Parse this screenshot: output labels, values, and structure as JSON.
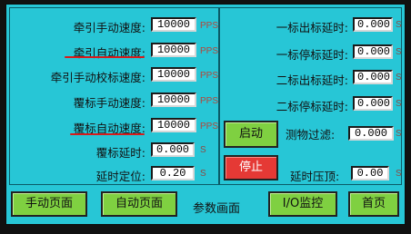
{
  "left": {
    "rows": [
      {
        "label": "牵引手动速度:",
        "value": "10000",
        "unit": "PPS"
      },
      {
        "label": "牵引自动速度:",
        "value": "10000",
        "unit": "PPS"
      },
      {
        "label": "牵引手动校标速度:",
        "value": "10000",
        "unit": "PPS"
      },
      {
        "label": "覆标手动速度:",
        "value": "10000",
        "unit": "PPS"
      },
      {
        "label": "覆标自动速度:",
        "value": "10000",
        "unit": "PPS"
      },
      {
        "label": "覆标延时:",
        "value": "0.000",
        "unit": "S"
      },
      {
        "label": "延时定位:",
        "value": "0.20",
        "unit": "S"
      }
    ]
  },
  "right": {
    "rows": [
      {
        "label": "一标出标延时:",
        "value": "0.000",
        "unit": "S"
      },
      {
        "label": "一标停标延时:",
        "value": "0.000",
        "unit": "S"
      },
      {
        "label": "二标出标延时:",
        "value": "0.000",
        "unit": "S"
      },
      {
        "label": "二标停标延时:",
        "value": "0.000",
        "unit": "S"
      }
    ],
    "filter": {
      "label": "测物过滤:",
      "value": "0.000",
      "unit": "S"
    },
    "pressure": {
      "label": "延时压顶:",
      "value": "0.00",
      "unit": "S"
    }
  },
  "buttons": {
    "start": "启动",
    "stop": "停止"
  },
  "nav": {
    "manual": "手动页面",
    "auto": "自动页面",
    "current": "参数画面",
    "io": "I/O监控",
    "home": "首页"
  },
  "colors": {
    "screen_bg": "#27c6d6",
    "button_green": "#7fd041",
    "button_red": "#e53935",
    "annotation_red": "#d61b1b"
  }
}
